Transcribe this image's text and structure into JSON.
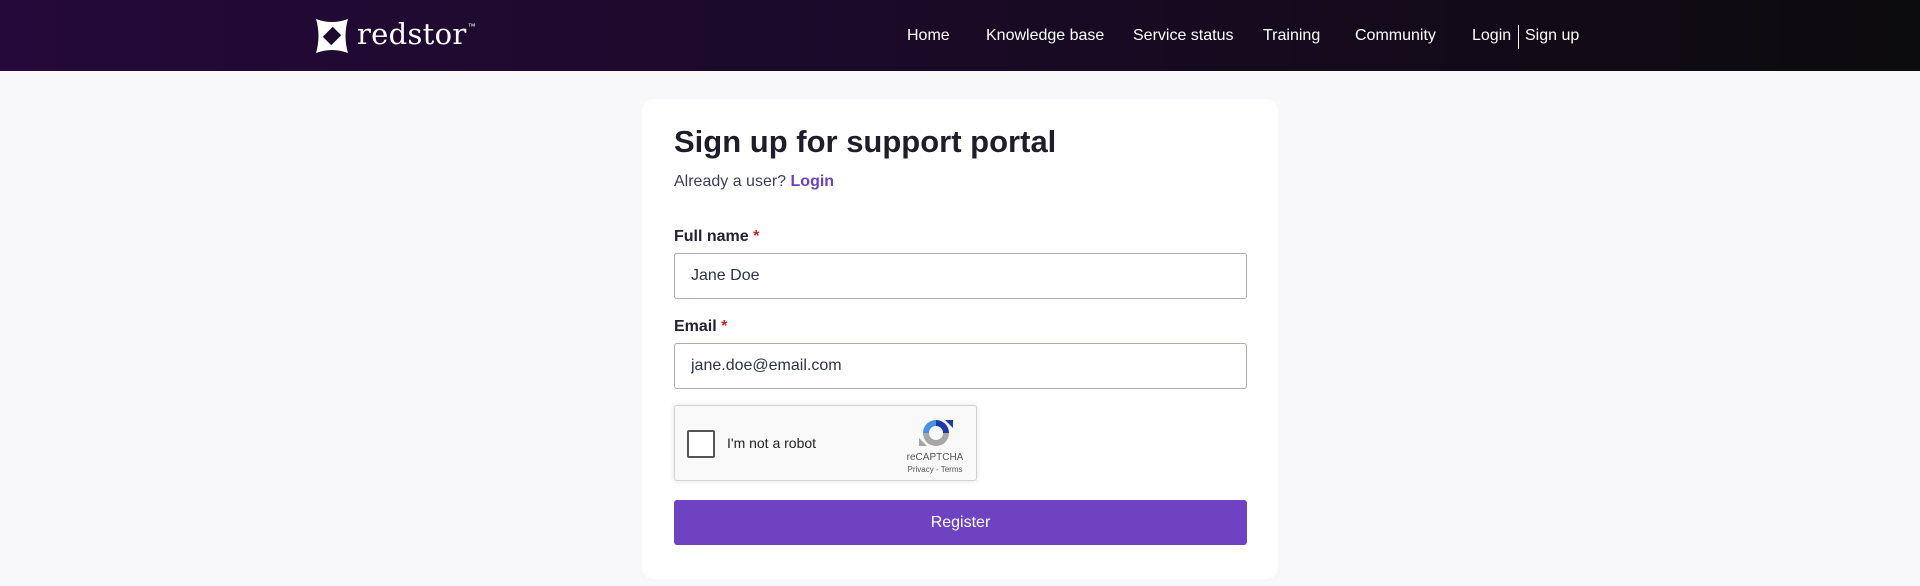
{
  "header": {
    "logo_text": "redstor",
    "logo_mark": "™",
    "nav": {
      "home": "Home",
      "knowledge_base": "Knowledge base",
      "service_status": "Service status",
      "training": "Training",
      "community": "Community",
      "login": "Login",
      "sign_up": "Sign up"
    }
  },
  "form": {
    "title": "Sign up for support portal",
    "already_text": "Already a user?",
    "login_link": "Login",
    "full_name_label": "Full name",
    "full_name_value": "Jane Doe",
    "email_label": "Email",
    "email_value": "jane.doe@email.com",
    "required_marker": "*",
    "register_label": "Register"
  },
  "recaptcha": {
    "label": "I'm not a robot",
    "brand": "reCAPTCHA",
    "privacy": "Privacy",
    "separator": " - ",
    "terms": "Terms",
    "icon": "recaptcha-logo"
  },
  "colors": {
    "accent": "#6f42c1",
    "header_start": "#24093a",
    "header_end": "#0c0b0d",
    "required": "#c2272d"
  }
}
